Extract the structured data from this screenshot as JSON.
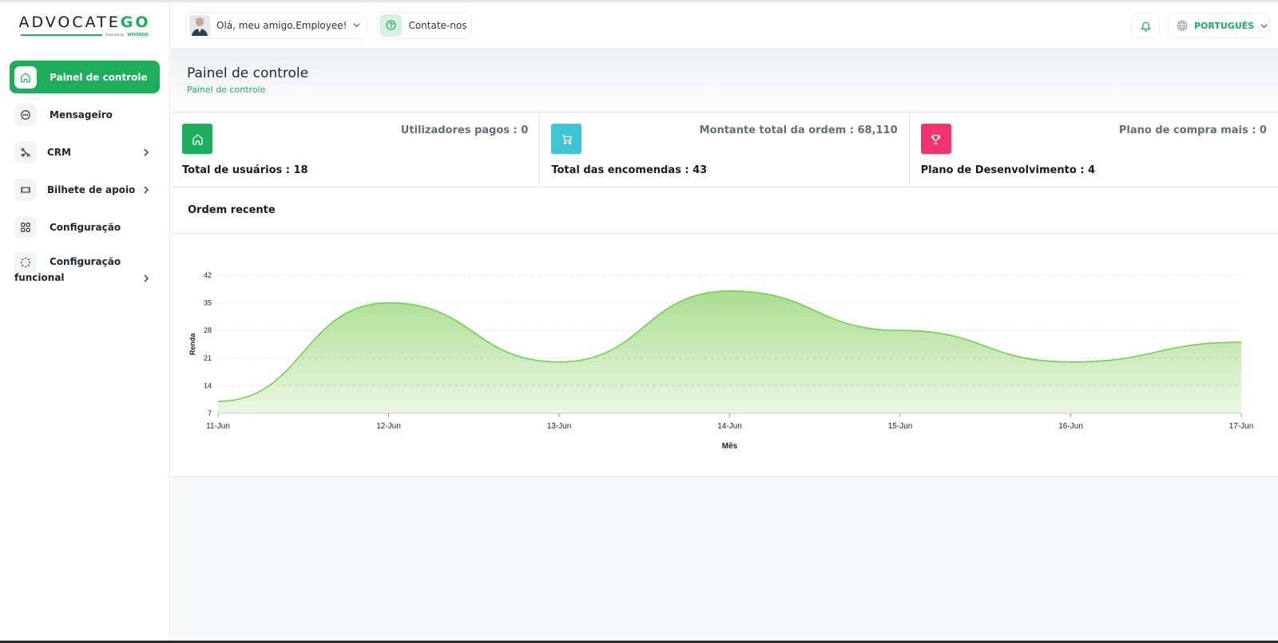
{
  "logo": {
    "text": "ADVOCATE",
    "accent": "GO",
    "powered": "Powered by",
    "brand": "WOOHOO"
  },
  "sidebar": {
    "items": [
      {
        "label": "Painel de controle",
        "icon": "home-icon",
        "active": true
      },
      {
        "label": "Mensageiro",
        "icon": "chat-icon"
      },
      {
        "label": "CRM",
        "icon": "crm-icon",
        "has_children": true
      },
      {
        "label": "Bilhete de apoio",
        "icon": "ticket-icon",
        "has_children": true
      },
      {
        "label": "Configuração",
        "icon": "grid-icon"
      },
      {
        "label": "Configuração",
        "label2": "funcional",
        "icon": "loader-icon",
        "has_children": true
      }
    ]
  },
  "header": {
    "greeting": "Olá, meu amigo.Employee!",
    "contact": "Contate-nos",
    "language": "PORTUGUÊS"
  },
  "page": {
    "title": "Painel de controle",
    "breadcrumb": "Painel de controle"
  },
  "stats": [
    {
      "top": "Utilizadores pagos : 0",
      "bottom": "Total de usuários : 18",
      "color": "#1cae5b",
      "icon": "home-icon"
    },
    {
      "top": "Montante total da ordem : 68,110",
      "bottom": "Total das encomendas : 43",
      "color": "#3ec6d6",
      "icon": "cart-icon"
    },
    {
      "top": "Plano de compra mais : 0",
      "bottom": "Plano de Desenvolvimento : 4",
      "color": "#f4336d",
      "icon": "trophy-icon"
    }
  ],
  "recent": {
    "title": "Ordem recente"
  },
  "colors": {
    "accent": "#1cae5b",
    "line": "#6fd14f"
  },
  "chart_data": {
    "type": "area",
    "x": [
      "11-Jun",
      "12-Jun",
      "13-Jun",
      "14-Jun",
      "15-Jun",
      "16-Jun",
      "17-Jun"
    ],
    "values": [
      10,
      35,
      20,
      38,
      28,
      20,
      25
    ],
    "yticks": [
      7,
      14,
      21,
      28,
      35,
      42
    ],
    "ylim": [
      7,
      42
    ],
    "xlabel": "Mês",
    "ylabel": "Renda",
    "grid": true
  }
}
